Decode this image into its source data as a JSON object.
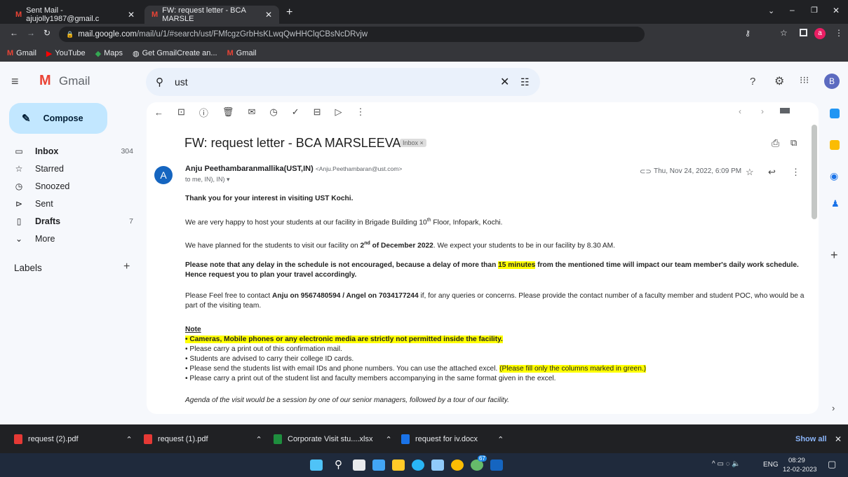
{
  "tabs": [
    {
      "title": "Sent Mail - ajujolly1987@gmail.c"
    },
    {
      "title": "FW: request letter - BCA MARSLE"
    }
  ],
  "url": {
    "host": "mail.google.com",
    "path": "/mail/u/1/#search/ust/FMfcgzGrbHsKLwqQwHHClqCBsNcDRvjw"
  },
  "bookmarks": [
    "Gmail",
    "YouTube",
    "Maps",
    "Get GmailCreate an...",
    "Gmail"
  ],
  "gmail": {
    "brand": "Gmail",
    "search": "ust",
    "compose": "Compose",
    "labels_heading": "Labels",
    "nav": [
      {
        "label": "Inbox",
        "count": "304"
      },
      {
        "label": "Starred",
        "count": ""
      },
      {
        "label": "Snoozed",
        "count": ""
      },
      {
        "label": "Sent",
        "count": ""
      },
      {
        "label": "Drafts",
        "count": "7"
      },
      {
        "label": "More",
        "count": ""
      }
    ],
    "avatar_letter": "B"
  },
  "email": {
    "subject": "FW: request letter - BCA MARSLEEVA",
    "badge": "Inbox",
    "sender_initial": "A",
    "sender": "Anju Peethambaranmallika(UST,IN)",
    "sender_email": "<Anju.Peethambaran@ust.com>",
    "date": "Thu, Nov 24, 2022, 6:09 PM",
    "to": "to me, IN), IN)",
    "b1": "Thank you for your interest in visiting UST Kochi.",
    "b2a": "We are very happy to host your students at our facility in Brigade Building 10",
    "b2sup": "th",
    "b2b": " Floor, Infopark, Kochi.",
    "b3a": "We have planned for the students to visit our facility on ",
    "b3sup": "nd",
    "b3n": "2",
    "b3c": " of December 2022",
    "b3d": ". We expect your students to be in our facility by 8.30 AM.",
    "b4a": "Please note that any delay in the schedule is not encouraged, because a delay of more than ",
    "b4hl": "15 minutes",
    "b4b": " from the mentioned time will impact our team member's daily work schedule. Hence request you to plan your travel accordingly.",
    "b5a": "Please Feel free to contact ",
    "b5b": "Anju on 9567480594 / Angel on 7034177244",
    "b5c": " if, for any queries or concerns. Please provide the contact number of a faculty member and student POC, who would be a part of the visiting team.",
    "note": "Note",
    "n1": "• Cameras, Mobile phones or any electronic media are strictly not permitted inside the facility.",
    "n2": "• Please carry a print out of this confirmation mail.",
    "n3": "• Students are advised to carry their college ID cards.",
    "n4a": "• Please send the students list with email IDs and phone numbers. You can use the attached excel. ",
    "n4hl": "(Please fill only the columns marked in green.)",
    "n5": "• Please carry a print out of the student list and faculty members accompanying in the same format given in the excel.",
    "agenda": "Agenda of the visit would be a session by one of our senior managers, followed by a tour of our facility."
  },
  "downloads": [
    {
      "name": "request (2).pdf"
    },
    {
      "name": "request (1).pdf"
    },
    {
      "name": "Corporate Visit stu....xlsx"
    },
    {
      "name": "request for iv.docx"
    }
  ],
  "show_all": "Show all",
  "taskbar": {
    "lang": "ENG",
    "time": "08:29",
    "date": "12-02-2023",
    "badge": "67"
  },
  "colors": {
    "accent": "#0b57d0",
    "highlight": "#ffff00"
  }
}
